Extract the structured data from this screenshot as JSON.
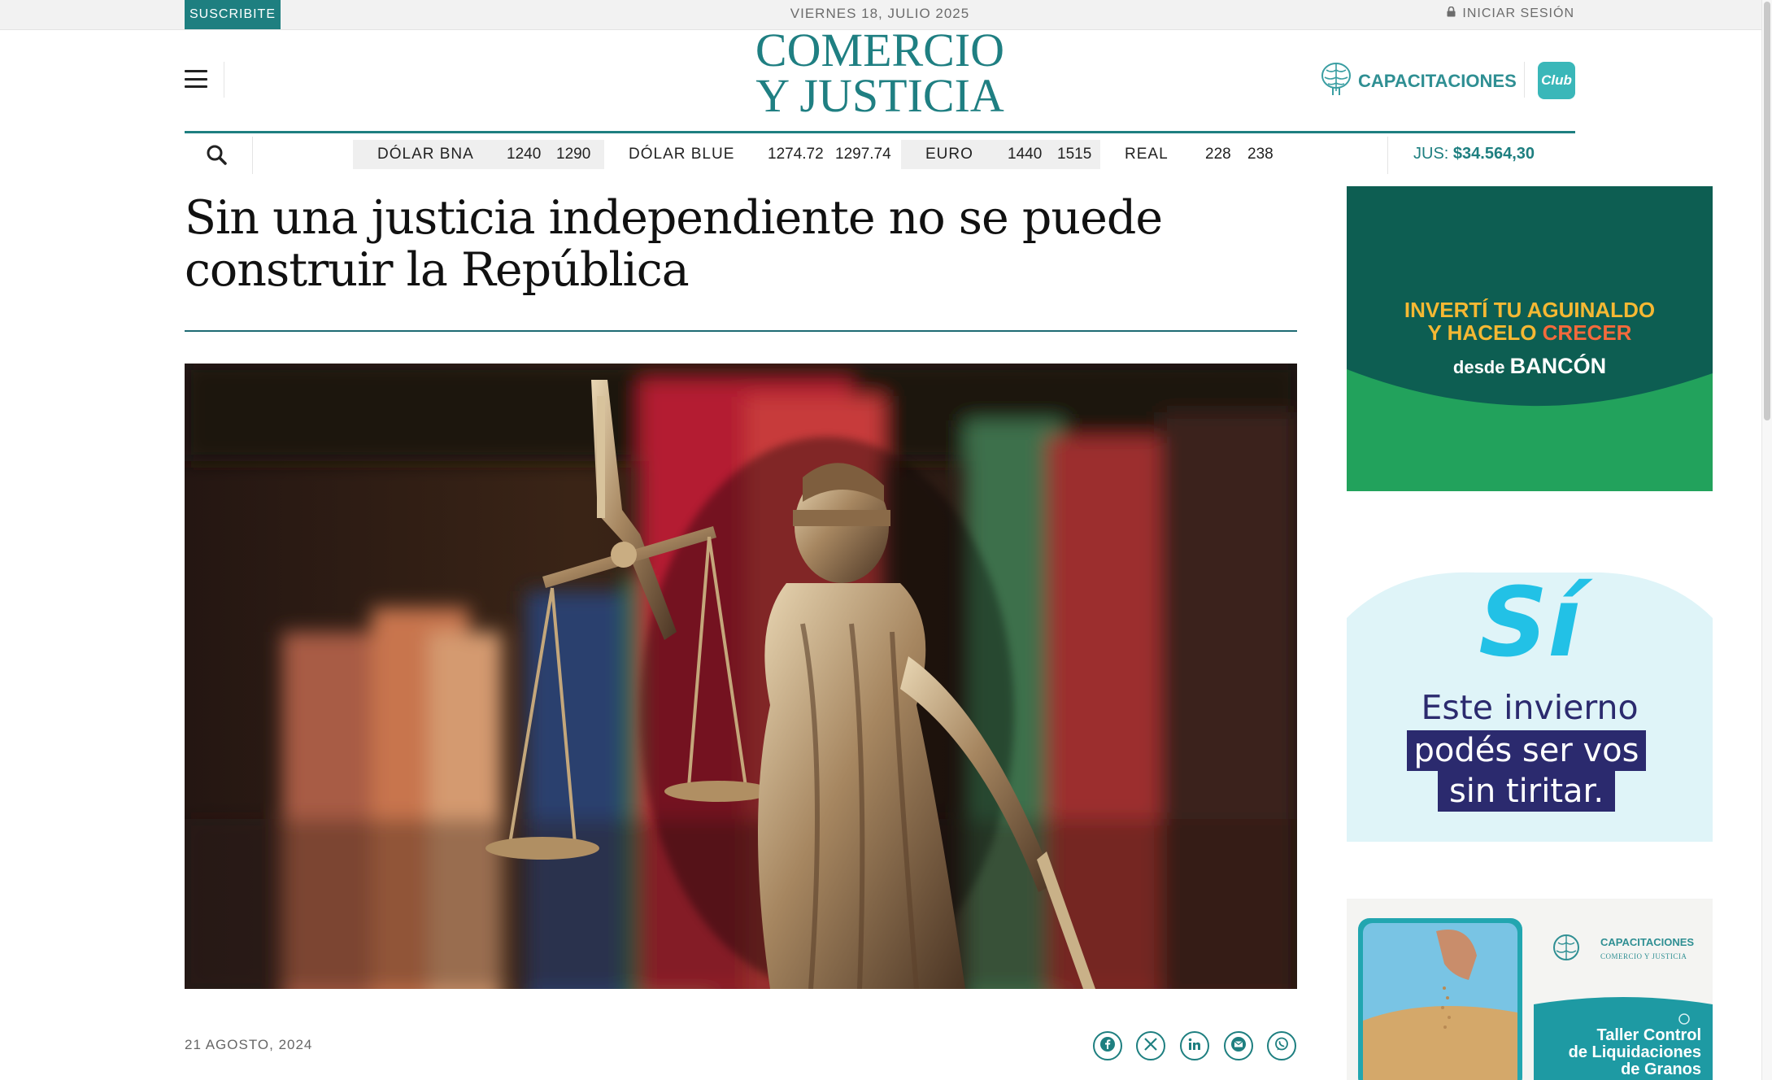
{
  "topbar": {
    "subscribe_label": "SUSCRIBITE",
    "date": "VIERNES 18, JULIO 2025",
    "login_label": "INICIAR SESIÓN"
  },
  "header": {
    "logo_line1": "COMERCIO",
    "logo_line2": "Y JUSTICIA",
    "capacitaciones_label": "CAPACITACIONES",
    "club_label": "Club"
  },
  "currency_bar": {
    "rates": [
      {
        "name": "DÓLAR BNA",
        "buy": "1240",
        "sell": "1290"
      },
      {
        "name": "DÓLAR BLUE",
        "buy": "1274.72",
        "sell": "1297.74"
      },
      {
        "name": "EURO",
        "buy": "1440",
        "sell": "1515"
      },
      {
        "name": "REAL",
        "buy": "228",
        "sell": "238"
      }
    ],
    "jus_label": "JUS:",
    "jus_value": "$34.564,30"
  },
  "article": {
    "title_line1": "Sin una justicia independiente no se puede",
    "title_line2": "construir la República",
    "date": "21 AGOSTO, 2024"
  },
  "share": [
    {
      "icon": "facebook-icon"
    },
    {
      "icon": "x-icon"
    },
    {
      "icon": "linkedin-icon"
    },
    {
      "icon": "email-icon"
    },
    {
      "icon": "whatsapp-icon"
    }
  ],
  "ads": {
    "bancon": {
      "line1": "INVERTÍ TU AGUINALDO",
      "line2a": "Y HACELO ",
      "line2b": "CRECER",
      "line3a": "desde ",
      "line3b": "BANCÓN"
    },
    "winter": {
      "big": "Sí",
      "line1": "Este invierno",
      "line2": "podés ser vos",
      "line3": "sin tiritar."
    },
    "course": {
      "brand": "CAPACITACIONES",
      "brand_sub": "COMERCIO Y JUSTICIA",
      "line1": "Taller Control",
      "line2": "de Liquidaciones",
      "line3": "de Granos"
    }
  },
  "colors": {
    "brand_teal": "#1e7f80",
    "bancon_dark": "#0d5e52",
    "bancon_green": "#22a25c",
    "bancon_yellow": "#f5b833",
    "winter_cyan": "#22c1e6",
    "winter_navy": "#2b2a6e"
  }
}
